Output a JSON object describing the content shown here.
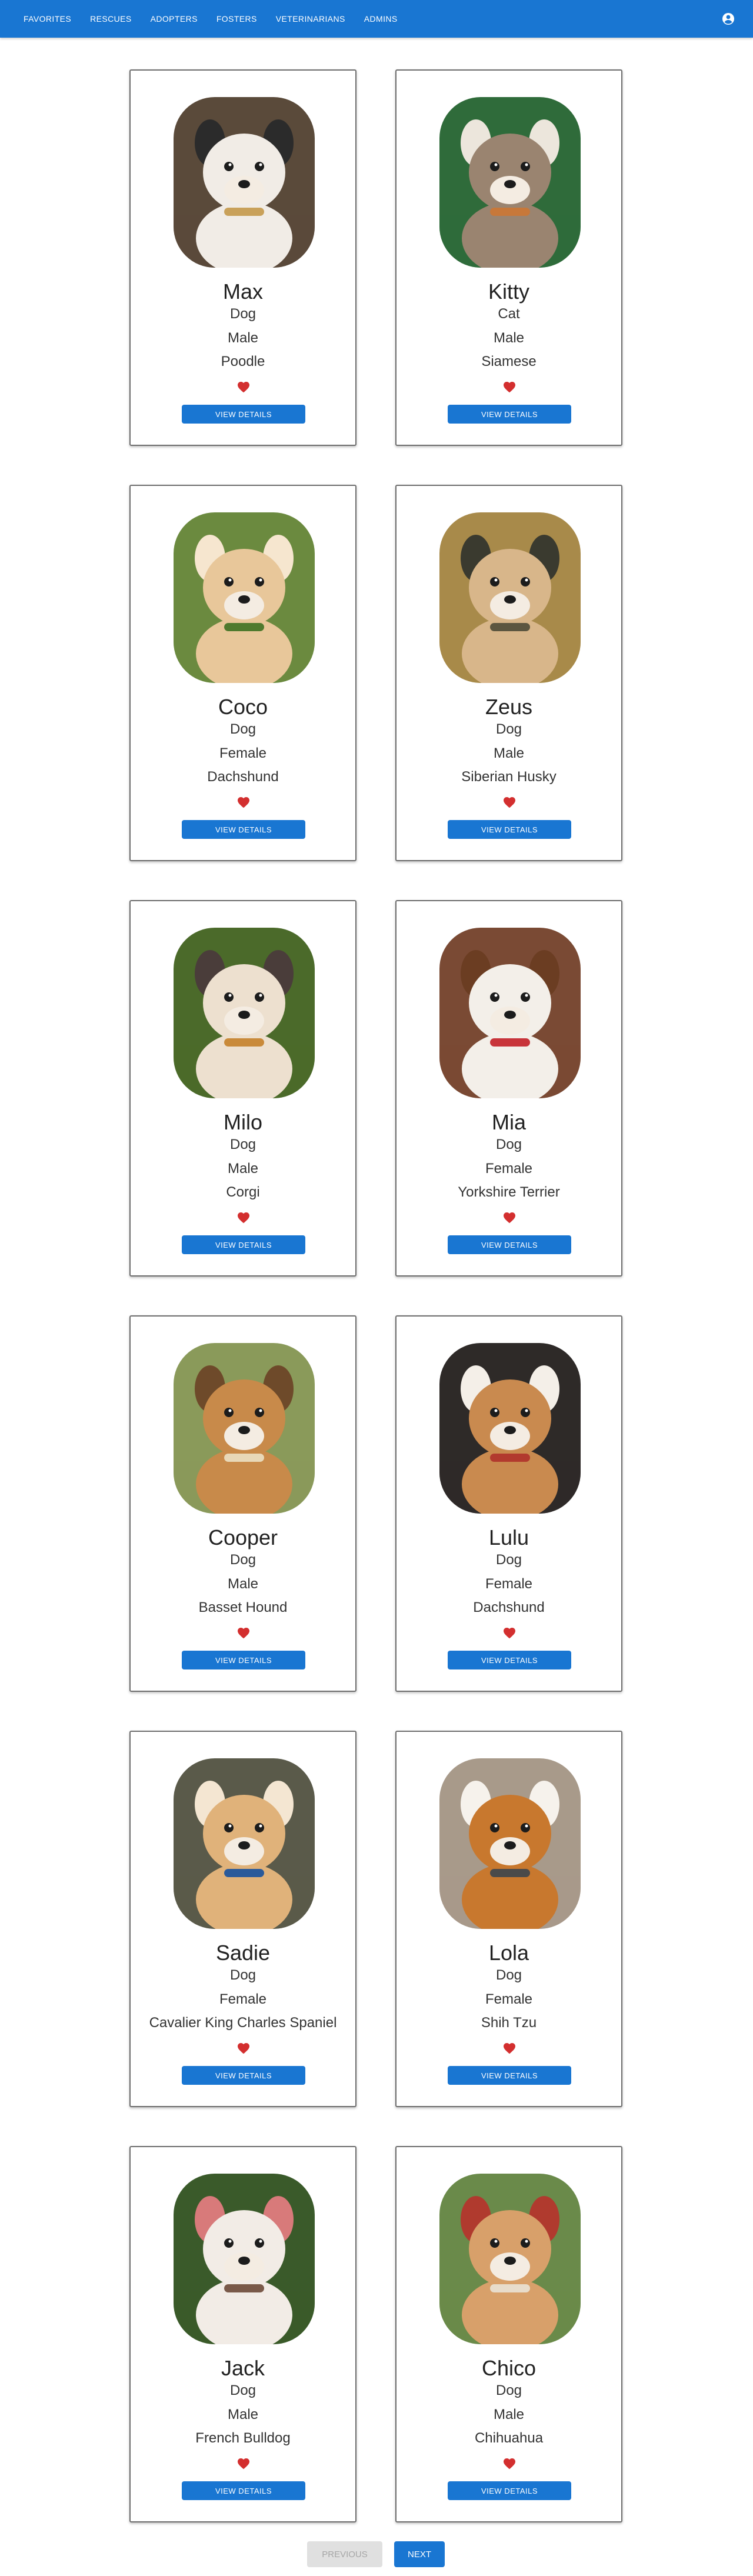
{
  "nav": {
    "items": [
      "FAVORITES",
      "RESCUES",
      "ADOPTERS",
      "FOSTERS",
      "VETERINARIANS",
      "ADMINS"
    ],
    "account_icon": "account-circle-icon"
  },
  "colors": {
    "primary": "#1976d2",
    "heart": "#d32f2f",
    "disabled_bg": "#e0e0e0",
    "disabled_text": "#a6a6a6"
  },
  "pets": [
    {
      "name": "Max",
      "type": "Dog",
      "gender": "Male",
      "breed": "Poodle",
      "button": "VIEW DETAILS",
      "photo": {
        "bg": "#5a4a3a",
        "fur": "#f1ece6",
        "accent": "#2b2b2b",
        "prop": "#c9a15a"
      }
    },
    {
      "name": "Kitty",
      "type": "Cat",
      "gender": "Male",
      "breed": "Siamese",
      "button": "VIEW DETAILS",
      "photo": {
        "bg": "#2f6b3a",
        "fur": "#9a8470",
        "accent": "#ece6dc",
        "prop": "#c7783a"
      }
    },
    {
      "name": "Coco",
      "type": "Dog",
      "gender": "Female",
      "breed": "Dachshund",
      "button": "VIEW DETAILS",
      "photo": {
        "bg": "#6b8a3f",
        "fur": "#e8c79a",
        "accent": "#f6e6cf",
        "prop": "#4f7a2e"
      }
    },
    {
      "name": "Zeus",
      "type": "Dog",
      "gender": "Male",
      "breed": "Siberian Husky",
      "button": "VIEW DETAILS",
      "photo": {
        "bg": "#a88a4a",
        "fur": "#d8b68a",
        "accent": "#3a3a2f",
        "prop": "#5c5640"
      }
    },
    {
      "name": "Milo",
      "type": "Dog",
      "gender": "Male",
      "breed": "Corgi",
      "button": "VIEW DETAILS",
      "photo": {
        "bg": "#4b6a2a",
        "fur": "#ede0cf",
        "accent": "#4a3d3a",
        "prop": "#c98a3a"
      }
    },
    {
      "name": "Mia",
      "type": "Dog",
      "gender": "Female",
      "breed": "Yorkshire Terrier",
      "button": "VIEW DETAILS",
      "photo": {
        "bg": "#7a4a34",
        "fur": "#f3efe9",
        "accent": "#6b3d22",
        "prop": "#c8343a"
      }
    },
    {
      "name": "Cooper",
      "type": "Dog",
      "gender": "Male",
      "breed": "Basset Hound",
      "button": "VIEW DETAILS",
      "photo": {
        "bg": "#8a9a5a",
        "fur": "#c88a4a",
        "accent": "#6e4a2a",
        "prop": "#e8d8b8"
      }
    },
    {
      "name": "Lulu",
      "type": "Dog",
      "gender": "Female",
      "breed": "Dachshund",
      "button": "VIEW DETAILS",
      "photo": {
        "bg": "#2e2a28",
        "fur": "#c98a4f",
        "accent": "#f4efe8",
        "prop": "#b23a2e"
      }
    },
    {
      "name": "Sadie",
      "type": "Dog",
      "gender": "Female",
      "breed": "Cavalier King Charles Spaniel",
      "button": "VIEW DETAILS",
      "photo": {
        "bg": "#5a5a4a",
        "fur": "#e0b27a",
        "accent": "#f4e6d2",
        "prop": "#2a5a9a"
      }
    },
    {
      "name": "Lola",
      "type": "Dog",
      "gender": "Female",
      "breed": "Shih Tzu",
      "button": "VIEW DETAILS",
      "photo": {
        "bg": "#a89a8a",
        "fur": "#c8782e",
        "accent": "#f6f2ec",
        "prop": "#4a4a4a"
      }
    },
    {
      "name": "Jack",
      "type": "Dog",
      "gender": "Male",
      "breed": "French Bulldog",
      "button": "VIEW DETAILS",
      "photo": {
        "bg": "#3a5a2a",
        "fur": "#f2ece6",
        "accent": "#d87a7a",
        "prop": "#7a5a4a"
      }
    },
    {
      "name": "Chico",
      "type": "Dog",
      "gender": "Male",
      "breed": "Chihuahua",
      "button": "VIEW DETAILS",
      "photo": {
        "bg": "#6a8a4a",
        "fur": "#d8a06a",
        "accent": "#b03a2e",
        "prop": "#e8dccb"
      }
    }
  ],
  "pagination": {
    "previous_label": "PREVIOUS",
    "next_label": "NEXT",
    "previous_disabled": true
  }
}
